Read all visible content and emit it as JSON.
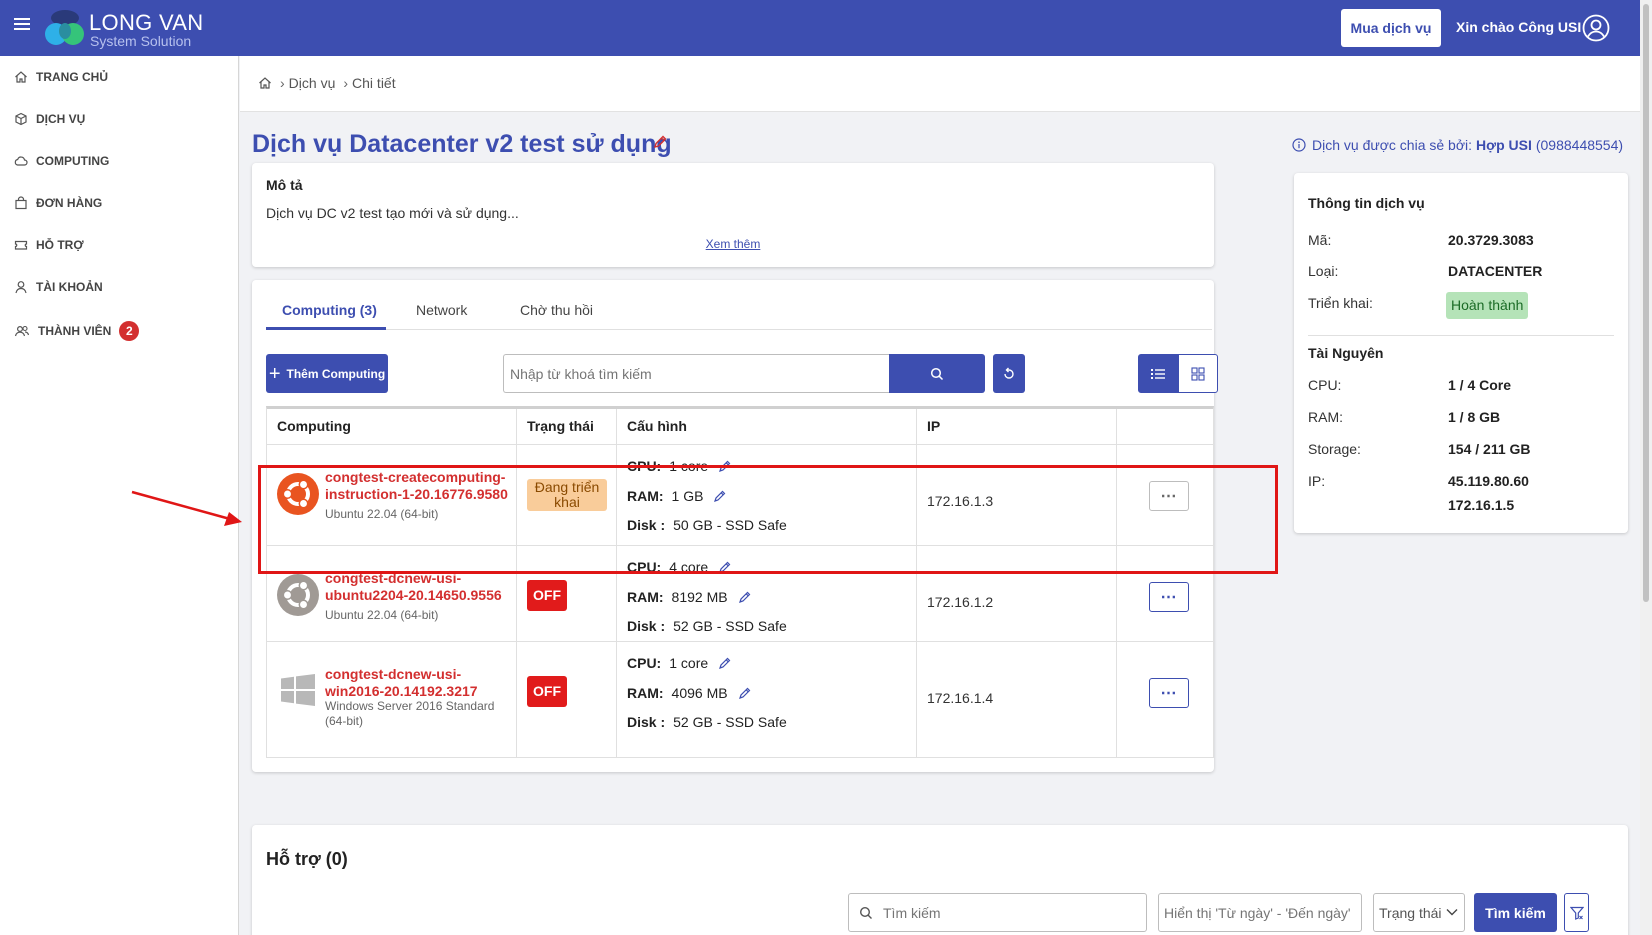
{
  "header": {
    "logo_line1": "LONG VAN",
    "logo_line2": "System Solution",
    "buy_button": "Mua dịch vụ",
    "greeting": "Xin chào Công USI",
    "icons": {
      "menu": "hamburger-icon",
      "user": "user-circle-icon"
    }
  },
  "sidebar": {
    "items": [
      {
        "label": "TRANG CHỦ",
        "icon": "home-icon"
      },
      {
        "label": "DỊCH VỤ",
        "icon": "cube-icon"
      },
      {
        "label": "COMPUTING",
        "icon": "cloud-icon"
      },
      {
        "label": "ĐƠN HÀNG",
        "icon": "bag-icon"
      },
      {
        "label": "HỖ TRỢ",
        "icon": "ticket-icon"
      },
      {
        "label": "TÀI KHOẢN",
        "icon": "user-icon"
      },
      {
        "label": "THÀNH VIÊN",
        "icon": "users-icon",
        "badge": "2"
      }
    ]
  },
  "breadcrumb": {
    "items": [
      "Dịch vụ",
      "Chi tiết"
    ]
  },
  "page": {
    "title": "Dịch vụ Datacenter v2 test sử dụng",
    "shared_prefix": "Dịch vụ được chia sẻ bởi:",
    "shared_owner": "Hợp USI",
    "shared_phone": "(0988448554)"
  },
  "description": {
    "title": "Mô tả",
    "text": "Dịch vụ DC v2 test tạo mới và sử dụng...",
    "more": "Xem thêm"
  },
  "tabs": [
    {
      "label": "Computing (3)",
      "active": true
    },
    {
      "label": "Network",
      "active": false
    },
    {
      "label": "Chờ thu hồi",
      "active": false
    }
  ],
  "toolbar": {
    "add_button": "Thêm Computing",
    "search_placeholder": "Nhập từ khoá tìm kiếm"
  },
  "table": {
    "headers": [
      "Computing",
      "Trạng thái",
      "Cấu hình",
      "IP"
    ],
    "spec_labels": {
      "cpu": "CPU:",
      "ram": "RAM:",
      "disk": "Disk :"
    },
    "rows": [
      {
        "name": "congtest-createcomputing-instruction-1-20.16776.9580",
        "os": "Ubuntu 22.04 (64-bit)",
        "os_icon": "ubuntu-icon",
        "status": "Đang triển khai",
        "cpu": "1 core",
        "ram": "1 GB",
        "disk": "50 GB - SSD Safe",
        "ip": "172.16.1.3",
        "action": "⋯"
      },
      {
        "name": "congtest-dcnew-usi-ubuntu2204-20.14650.9556",
        "os": "Ubuntu 22.04 (64-bit)",
        "os_icon": "ubuntu-icon",
        "status": "OFF",
        "cpu": "4 core",
        "ram": "8192 MB",
        "disk": "52 GB - SSD Safe",
        "ip": "172.16.1.2",
        "action": "⋯"
      },
      {
        "name": "congtest-dcnew-usi-win2016-20.14192.3217",
        "os": "Windows Server 2016 Standard (64-bit)",
        "os_icon": "windows-icon",
        "status": "OFF",
        "cpu": "1 core",
        "ram": "4096 MB",
        "disk": "52 GB - SSD Safe",
        "ip": "172.16.1.4",
        "action": "⋯"
      }
    ]
  },
  "service_info": {
    "title": "Thông tin dịch vụ",
    "code_label": "Mã:",
    "code": "20.3729.3083",
    "type_label": "Loại:",
    "type": "DATACENTER",
    "deploy_label": "Triển khai:",
    "deploy": "Hoàn thành",
    "resources_title": "Tài Nguyên",
    "cpu_label": "CPU:",
    "cpu": "1 / 4 Core",
    "ram_label": "RAM:",
    "ram": "1 / 8 GB",
    "storage_label": "Storage:",
    "storage": "154 / 211 GB",
    "ip_label": "IP:",
    "ip1": "45.119.80.60",
    "ip2": "172.16.1.5"
  },
  "support": {
    "title": "Hỗ trợ (0)",
    "search_placeholder": "Tìm kiếm",
    "date_placeholder": "Hiển thị 'Từ ngày' - 'Đến ngày'",
    "status_label": "Trạng thái",
    "search_button": "Tìm kiếm"
  },
  "colors": {
    "primary": "#3d4eb0",
    "danger": "#e11b1b",
    "success_bg": "#b5e3b8",
    "warning_bg": "#f9cc9a"
  }
}
